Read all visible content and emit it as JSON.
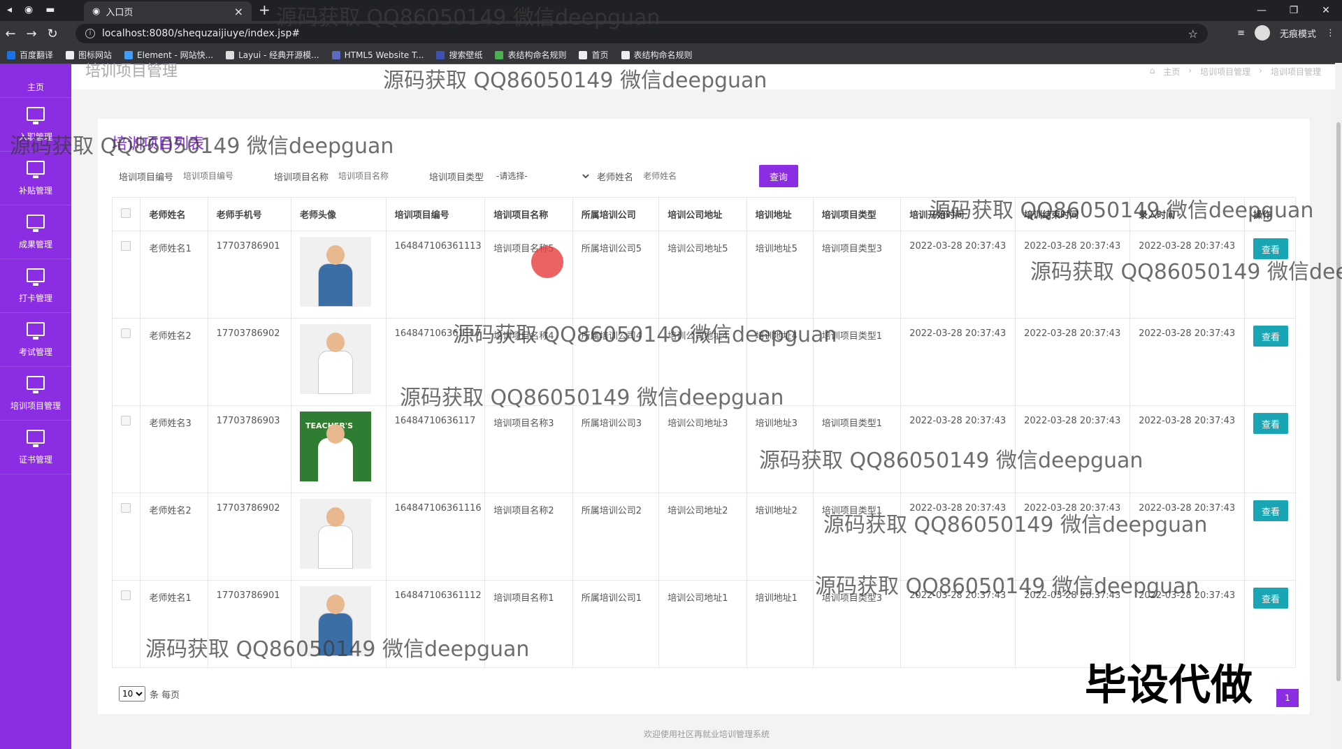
{
  "browser": {
    "tab_title": "入口页",
    "url": "localhost:8080/shequzaijiuye/index.jsp#",
    "incognito_label": "无痕模式",
    "bookmarks": [
      "百度翻译",
      "图标网站",
      "Element - 网站快...",
      "Layui - 经典开源模...",
      "HTML5 Website T...",
      "搜索壁纸",
      "表结构命名规则",
      "首页",
      "表结构命名规则"
    ]
  },
  "sidebar": {
    "items": [
      {
        "label": "主页"
      },
      {
        "label": "入职管理"
      },
      {
        "label": "补贴管理"
      },
      {
        "label": "成果管理"
      },
      {
        "label": "打卡管理"
      },
      {
        "label": "考试管理"
      },
      {
        "label": "培训项目管理"
      },
      {
        "label": "证书管理"
      }
    ]
  },
  "page": {
    "title": "培训项目管理",
    "breadcrumb": [
      "主页",
      "培训项目管理",
      "培训项目管理"
    ],
    "panel_title": "培训项目列表"
  },
  "search": {
    "code_label": "培训项目编号",
    "code_placeholder": "培训项目编号",
    "name_label": "培训项目名称",
    "name_placeholder": "培训项目名称",
    "type_label": "培训项目类型",
    "type_value": "-请选择-",
    "teacher_label": "老师姓名",
    "teacher_placeholder": "老师姓名",
    "query_button": "查询"
  },
  "table": {
    "headers": [
      "老师姓名",
      "老师手机号",
      "老师头像",
      "培训项目编号",
      "培训项目名称",
      "所属培训公司",
      "培训公司地址",
      "培训地址",
      "培训项目类型",
      "培训开始时间",
      "培训结束时间",
      "录入时间",
      "操作"
    ],
    "rows": [
      {
        "teacher": "老师姓名1",
        "phone": "17703786901",
        "avatar": "man",
        "code": "164847106361113",
        "name": "培训项目名称5",
        "company": "所属培训公司5",
        "company_addr": "培训公司地址5",
        "addr": "培训地址5",
        "type": "培训项目类型3",
        "start": "2022-03-28 20:37:43",
        "end": "2022-03-28 20:37:43",
        "created": "2022-03-28 20:37:43",
        "action": "查看"
      },
      {
        "teacher": "老师姓名2",
        "phone": "17703786902",
        "avatar": "woman",
        "code": "164847106361117",
        "name": "培训项目名称4",
        "company": "所属培训公司4",
        "company_addr": "培训公司地址4",
        "addr": "培训地址4",
        "type": "培训项目类型1",
        "start": "2022-03-28 20:37:43",
        "end": "2022-03-28 20:37:43",
        "created": "2022-03-28 20:37:43",
        "action": "查看"
      },
      {
        "teacher": "老师姓名3",
        "phone": "17703786903",
        "avatar": "teacher-day",
        "code": "16484710636117",
        "name": "培训项目名称3",
        "company": "所属培训公司3",
        "company_addr": "培训公司地址3",
        "addr": "培训地址3",
        "type": "培训项目类型1",
        "start": "2022-03-28 20:37:43",
        "end": "2022-03-28 20:37:43",
        "created": "2022-03-28 20:37:43",
        "action": "查看"
      },
      {
        "teacher": "老师姓名2",
        "phone": "17703786902",
        "avatar": "woman",
        "code": "164847106361116",
        "name": "培训项目名称2",
        "company": "所属培训公司2",
        "company_addr": "培训公司地址2",
        "addr": "培训地址2",
        "type": "培训项目类型1",
        "start": "2022-03-28 20:37:43",
        "end": "2022-03-28 20:37:43",
        "created": "2022-03-28 20:37:43",
        "action": "查看"
      },
      {
        "teacher": "老师姓名1",
        "phone": "17703786901",
        "avatar": "man",
        "code": "164847106361112",
        "name": "培训项目名称1",
        "company": "所属培训公司1",
        "company_addr": "培训公司地址1",
        "addr": "培训地址1",
        "type": "培训项目类型3",
        "start": "2022-03-28 20:37:43",
        "end": "2022-03-28 20:37:43",
        "created": "2022-03-28 20:37:43",
        "action": "查看"
      }
    ],
    "avatar_text": "TEACHER'S"
  },
  "pager": {
    "page_size": "10",
    "per_page_label": "条 每页",
    "current_page": "1"
  },
  "footer": "欢迎使用社区再就业培训管理系统",
  "stamp": "毕设代做",
  "watermark": "源码获取 QQ86050149 微信deepguan",
  "colors": {
    "accent": "#8b2de2",
    "view_button": "#1aa5b4"
  }
}
